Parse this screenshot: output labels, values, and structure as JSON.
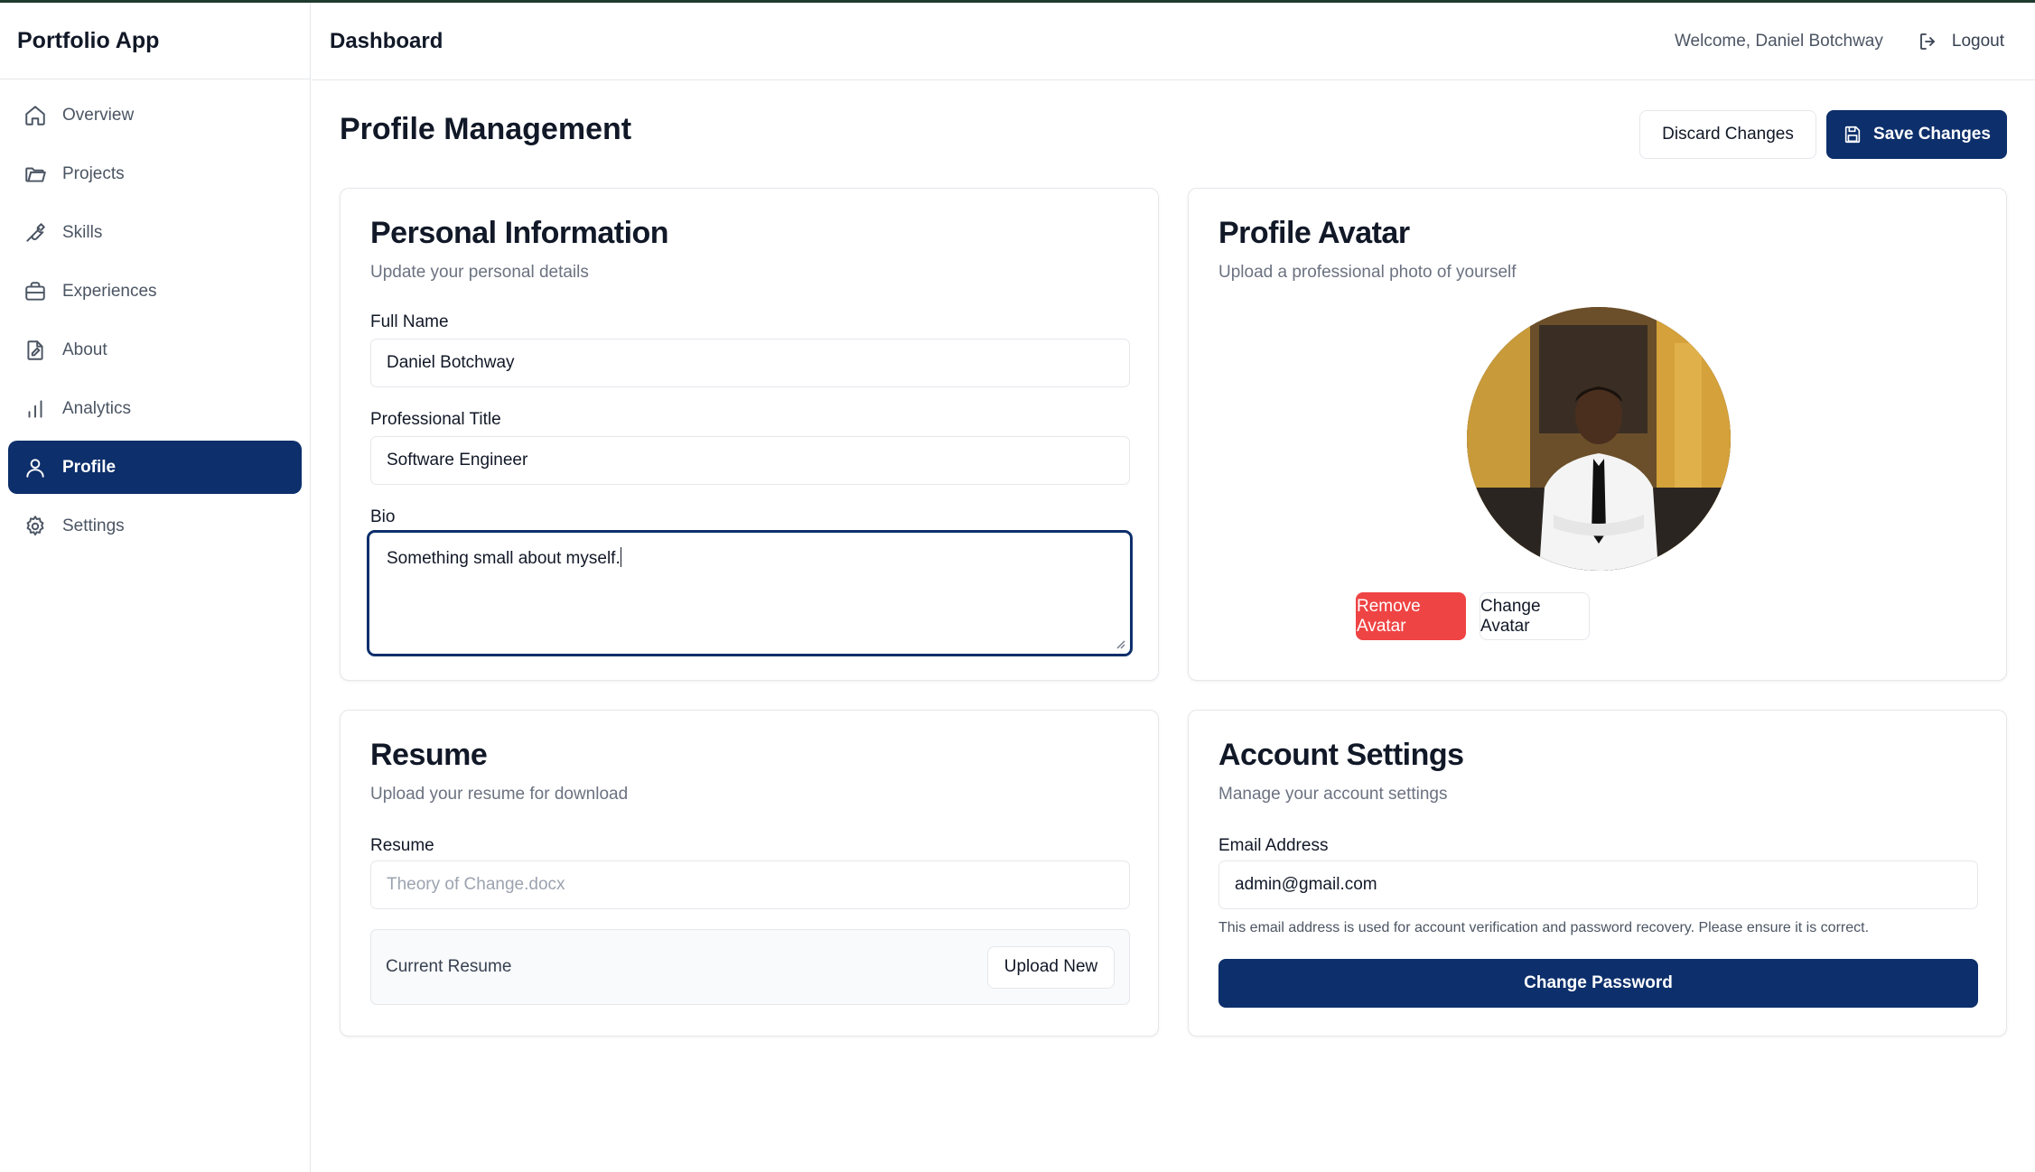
{
  "app": {
    "name": "Portfolio App"
  },
  "sidebar": {
    "items": [
      {
        "label": "Overview",
        "icon": "home-icon",
        "active": false
      },
      {
        "label": "Projects",
        "icon": "folder-icon",
        "active": false
      },
      {
        "label": "Skills",
        "icon": "wrench-icon",
        "active": false
      },
      {
        "label": "Experiences",
        "icon": "briefcase-icon",
        "active": false
      },
      {
        "label": "About",
        "icon": "document-icon",
        "active": false
      },
      {
        "label": "Analytics",
        "icon": "bar-chart-icon",
        "active": false
      },
      {
        "label": "Profile",
        "icon": "user-icon",
        "active": true
      },
      {
        "label": "Settings",
        "icon": "gear-icon",
        "active": false
      }
    ]
  },
  "header": {
    "title": "Dashboard",
    "welcome": "Welcome, Daniel Botchway",
    "logout": "Logout"
  },
  "main": {
    "title": "Profile Management",
    "discard_label": "Discard Changes",
    "save_label": "Save Changes"
  },
  "personal": {
    "title": "Personal Information",
    "subtitle": "Update your personal details",
    "full_name_label": "Full Name",
    "full_name_value": "Daniel Botchway",
    "professional_title_label": "Professional Title",
    "professional_title_value": "Software Engineer",
    "bio_label": "Bio",
    "bio_value": "Something small about myself."
  },
  "avatar": {
    "title": "Profile Avatar",
    "subtitle": "Upload a professional photo of yourself",
    "remove_label": "Remove Avatar",
    "change_label": "Change Avatar"
  },
  "resume": {
    "title": "Resume",
    "subtitle": "Upload your resume for download",
    "field_label": "Resume",
    "file_name": "Theory of Change.docx",
    "current_label": "Current Resume",
    "upload_label": "Upload New"
  },
  "account": {
    "title": "Account Settings",
    "subtitle": "Manage your account settings",
    "email_label": "Email Address",
    "email_value": "admin@gmail.com",
    "help_text": "This email address is used for account verification and password recovery. Please ensure it is correct.",
    "change_password_label": "Change Password"
  },
  "colors": {
    "primary": "#0d2f6b",
    "danger": "#ef4444",
    "border": "#e5e7eb",
    "muted_text": "#6b7280"
  }
}
